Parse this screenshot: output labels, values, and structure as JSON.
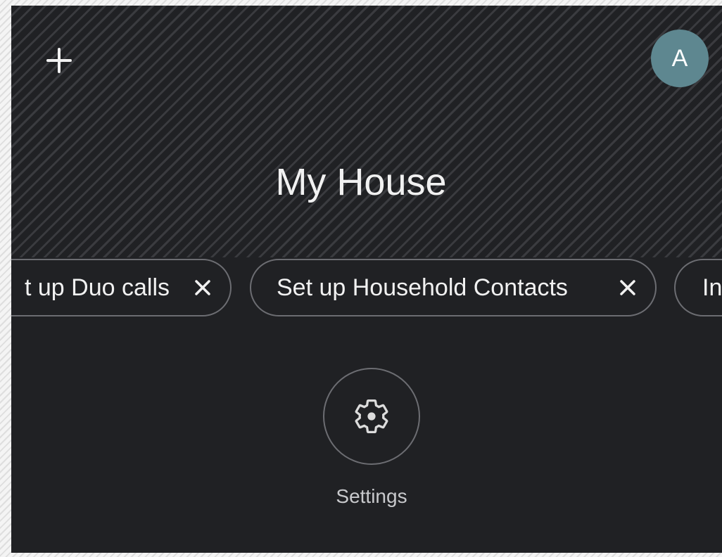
{
  "header": {
    "title": "My House",
    "avatar_initial": "A",
    "add_icon": "plus-icon"
  },
  "chips": [
    {
      "label": "Set up Duo calls",
      "visible_text": "t up Duo calls",
      "close_icon": "close-icon"
    },
    {
      "label": "Set up Household Contacts",
      "close_icon": "close-icon"
    },
    {
      "label": "In"
    }
  ],
  "actions": {
    "settings_label": "Settings",
    "settings_icon": "gear-icon"
  },
  "colors": {
    "background": "#202124",
    "text": "#f1f1f1",
    "outline": "#6c6d72",
    "avatar": "#5e8790"
  }
}
